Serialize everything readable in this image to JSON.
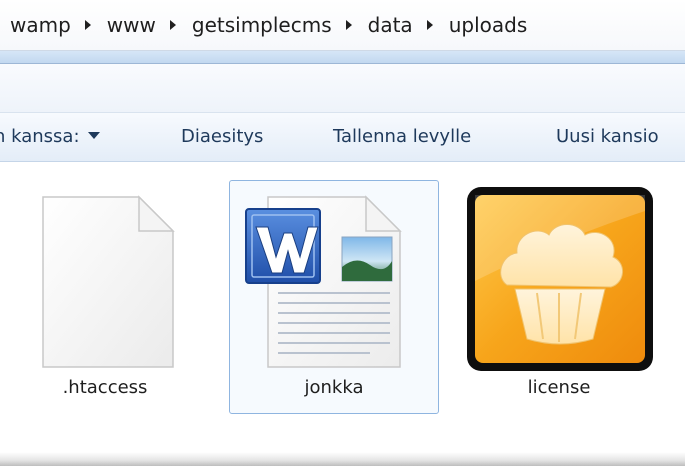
{
  "breadcrumb": {
    "items": [
      "wamp",
      "www",
      "getsimplecms",
      "data",
      "uploads"
    ]
  },
  "toolbar": {
    "share_label": "n kanssa:",
    "slideshow_label": "Diaesitys",
    "burn_label": "Tallenna levylle",
    "new_folder_label": "Uusi kansio"
  },
  "files": [
    {
      "name": ".htaccess",
      "icon": "blank-document-icon",
      "selected": false
    },
    {
      "name": "jonkka",
      "icon": "word-document-icon",
      "selected": true
    },
    {
      "name": "license",
      "icon": "cupcake-app-icon",
      "selected": false
    }
  ],
  "colors": {
    "selection_border": "#8fb5e0",
    "toolbar_text": "#1e395b",
    "word_blue": "#2b5ebd",
    "license_orange": "#f7a51b"
  }
}
